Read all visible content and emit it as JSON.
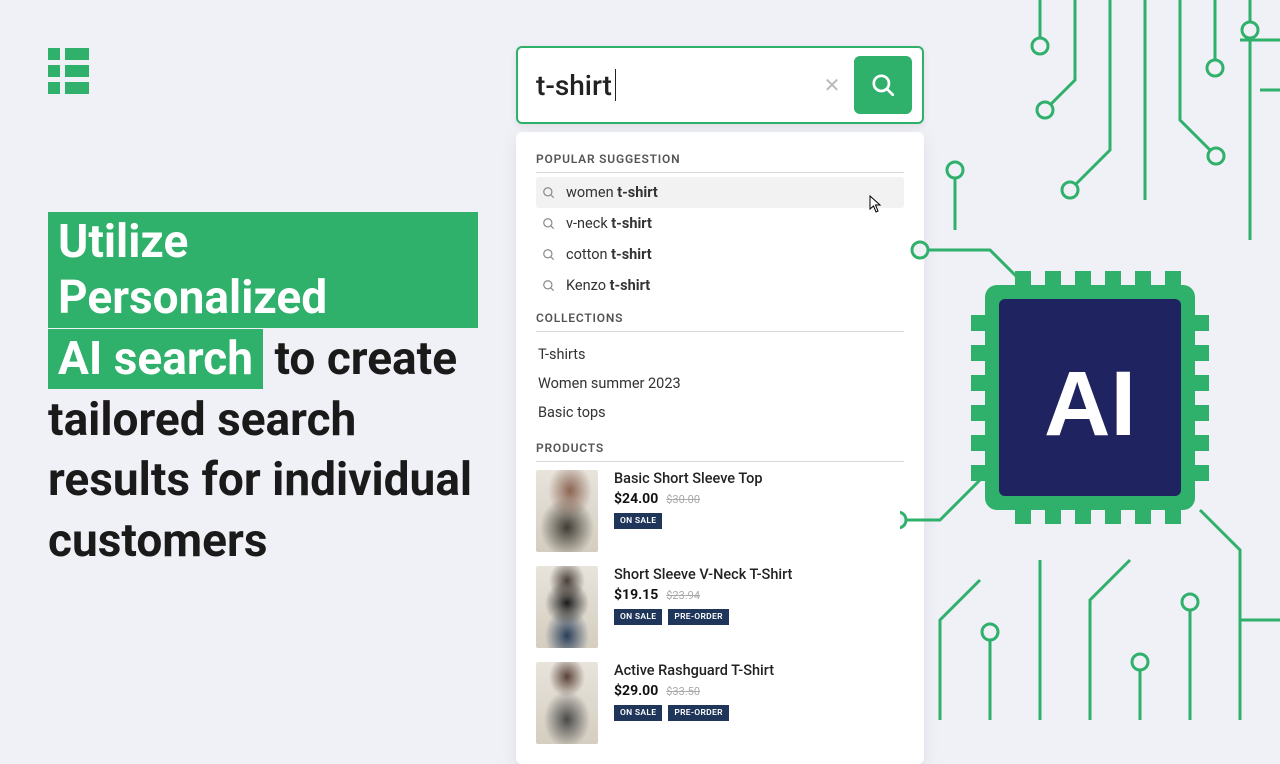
{
  "search": {
    "value": "t-shirt"
  },
  "sections": {
    "popular": "POPULAR SUGGESTION",
    "collections": "COLLECTIONS",
    "products": "PRODUCTS"
  },
  "suggestions": [
    {
      "prefix": "women ",
      "bold": "t-shirt"
    },
    {
      "prefix": "v-neck ",
      "bold": "t-shirt"
    },
    {
      "prefix": "cotton ",
      "bold": "t-shirt"
    },
    {
      "prefix": "Kenzo ",
      "bold": "t-shirt"
    }
  ],
  "collections": [
    "T-shirts",
    "Women summer 2023",
    "Basic tops"
  ],
  "products": [
    {
      "title": "Basic Short Sleeve Top",
      "price": "$24.00",
      "old": "$30.00",
      "tags": [
        "ON SALE"
      ]
    },
    {
      "title": "Short Sleeve V-Neck T-Shirt",
      "price": "$19.15",
      "old": "$23.94",
      "tags": [
        "ON SALE",
        "PRE-ORDER"
      ]
    },
    {
      "title": "Active Rashguard T-Shirt",
      "price": "$29.00",
      "old": "$33.50",
      "tags": [
        "ON SALE",
        "PRE-ORDER"
      ]
    }
  ],
  "headline": {
    "h1": "Utilize Personalized",
    "h2": "AI search",
    "rest": " to create tailored search results for individual customers"
  },
  "chip_label": "AI"
}
